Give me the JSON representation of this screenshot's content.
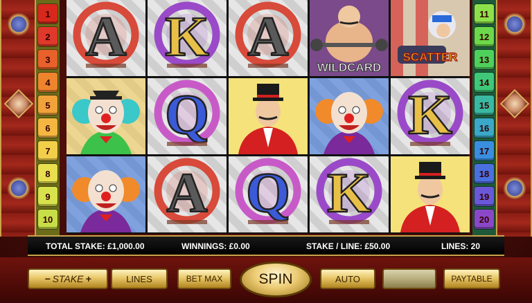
{
  "line_numbers_left": [
    {
      "label": "1",
      "color": "#d8281c"
    },
    {
      "label": "2",
      "color": "#e0382a"
    },
    {
      "label": "3",
      "color": "#e8602a"
    },
    {
      "label": "4",
      "color": "#ef842e"
    },
    {
      "label": "5",
      "color": "#f2a23a"
    },
    {
      "label": "6",
      "color": "#f5b642"
    },
    {
      "label": "7",
      "color": "#f2cf4a"
    },
    {
      "label": "8",
      "color": "#e8e04e"
    },
    {
      "label": "9",
      "color": "#d8e24c"
    },
    {
      "label": "10",
      "color": "#c8de48"
    }
  ],
  "line_numbers_right": [
    {
      "label": "11",
      "color": "#8ee04a"
    },
    {
      "label": "12",
      "color": "#6cd84a"
    },
    {
      "label": "13",
      "color": "#4ed05a"
    },
    {
      "label": "14",
      "color": "#3ec878"
    },
    {
      "label": "15",
      "color": "#3ab8a2"
    },
    {
      "label": "16",
      "color": "#3aa8c8"
    },
    {
      "label": "17",
      "color": "#3a8ee0"
    },
    {
      "label": "18",
      "color": "#4a70e0"
    },
    {
      "label": "19",
      "color": "#6a58d8"
    },
    {
      "label": "20",
      "color": "#8a48c8"
    }
  ],
  "reels": [
    [
      "letter-a",
      "clown-green",
      "clown-orange"
    ],
    [
      "letter-k",
      "letter-q",
      "letter-a"
    ],
    [
      "letter-a",
      "ringmaster",
      "letter-q"
    ],
    [
      "wildcard-strongman",
      "clown-orange",
      "letter-k"
    ],
    [
      "scatter-cannonball",
      "letter-k",
      "ringmaster"
    ]
  ],
  "symbol_labels": {
    "letter-a": "A",
    "letter-k": "K",
    "letter-q": "Q",
    "wildcard-strongman": "WILDCARD",
    "scatter-cannonball": "SCATTER"
  },
  "info": {
    "total_stake": "TOTAL STAKE: £1,000.00",
    "winnings": "WINNINGS:  £0.00",
    "stake_line": "STAKE / LINE: £50.00",
    "lines": "LINES: 20"
  },
  "controls": {
    "stake": "STAKE",
    "lines": "LINES",
    "bet_max": "BET MAX",
    "spin": "SPIN",
    "auto": "AUTO",
    "blank": "",
    "paytable": "PAYTABLE",
    "stake_minus": "−",
    "stake_plus": "+"
  },
  "colors": {
    "gold": "#e8c768",
    "frame_red": "#8a1d14"
  }
}
